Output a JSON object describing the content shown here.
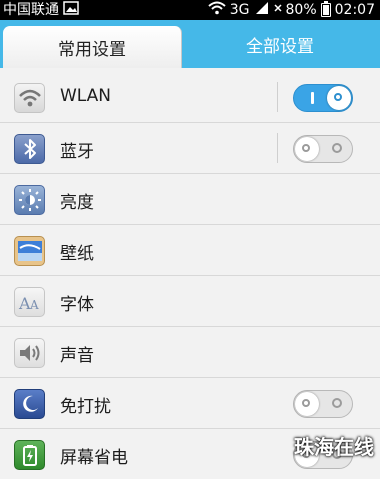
{
  "statusbar": {
    "carrier": "中国联通",
    "network": "3G",
    "battery": "80%",
    "time": "02:07"
  },
  "tabs": [
    {
      "label": "常用设置",
      "active": true
    },
    {
      "label": "全部设置",
      "active": false
    }
  ],
  "settings": [
    {
      "label": "WLAN",
      "toggle": "on"
    },
    {
      "label": "蓝牙",
      "toggle": "off"
    },
    {
      "label": "亮度"
    },
    {
      "label": "壁纸"
    },
    {
      "label": "字体"
    },
    {
      "label": "声音"
    },
    {
      "label": "免打扰",
      "toggle": "off"
    },
    {
      "label": "屏幕省电",
      "toggle": "off"
    }
  ],
  "watermark": "珠海在线",
  "colors": {
    "tab_bar": "#45b8e8",
    "toggle_on": "#3aa4e6",
    "background": "#f2f2f2"
  }
}
